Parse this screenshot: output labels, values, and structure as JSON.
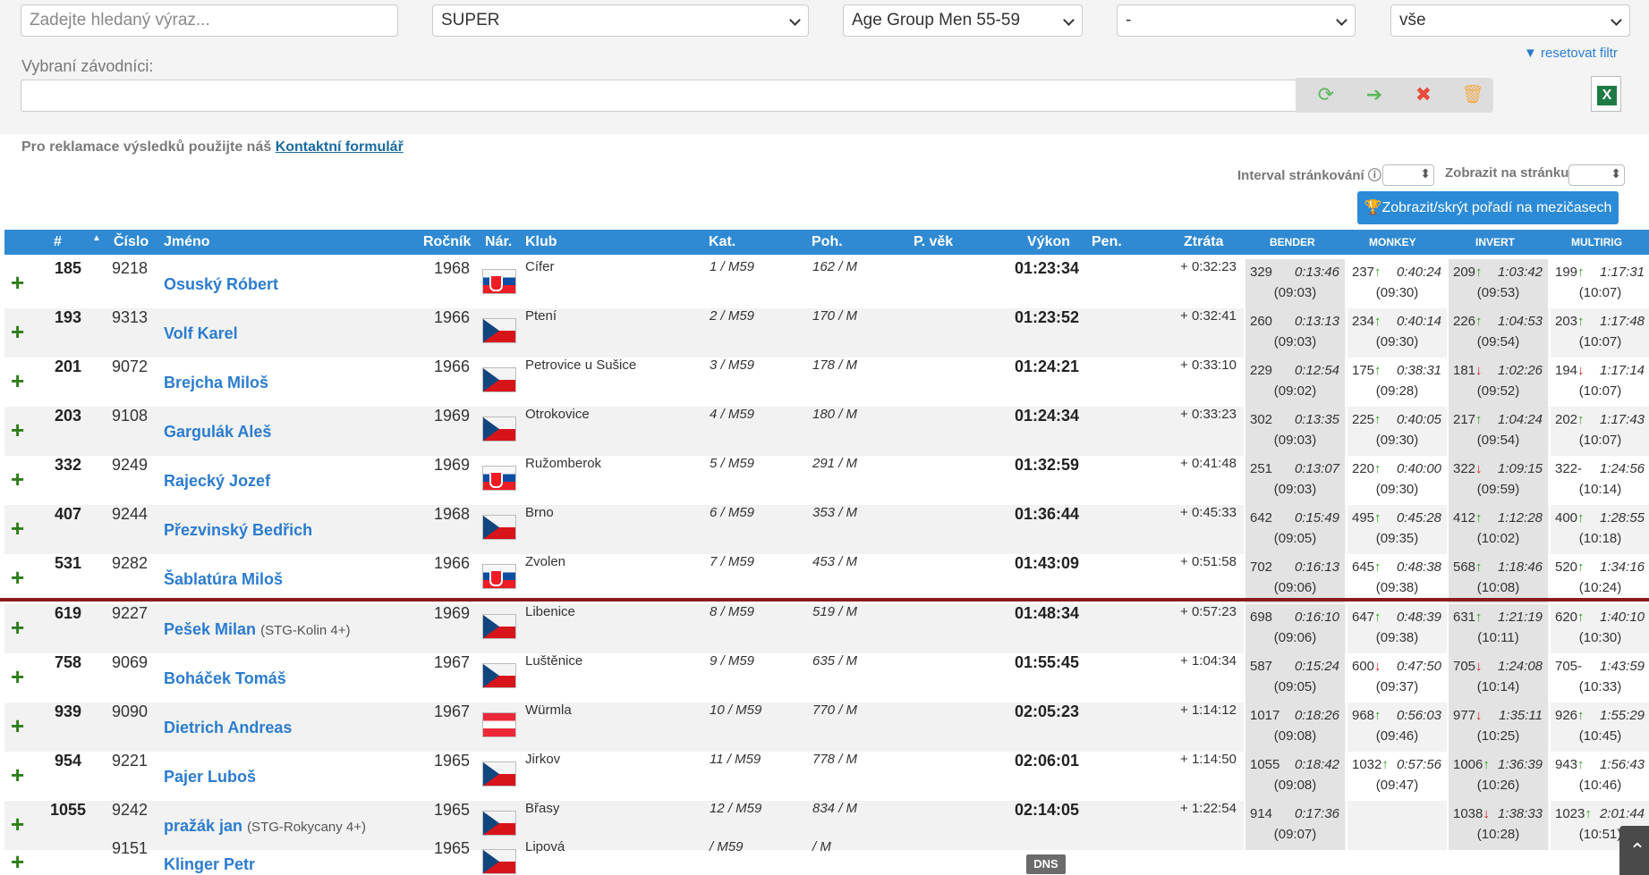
{
  "filters": {
    "search_placeholder": "Zadejte hledaný výraz...",
    "race": "SUPER",
    "category": "Age Group Men 55-59",
    "filter3": "-",
    "filter4": "vše",
    "reset_label": "resetovat filtr",
    "selected_label": "Vybraní závodníci:"
  },
  "notice": {
    "text": "Pro reklamace výsledků použijte náš ",
    "link": "Kontaktní formulář"
  },
  "paging": {
    "interval_label": "Interval stránkování",
    "per_page_label": "Zobrazit na stránku",
    "split_button": "Zobrazit/skrýt pořadí na mezičasech"
  },
  "headers": {
    "rank": "#",
    "number": "Číslo",
    "name": "Jméno",
    "year": "Ročník",
    "nat": "Nár.",
    "club": "Klub",
    "kat": "Kat.",
    "poh": "Poh.",
    "pvek": "P. věk",
    "vykon": "Výkon",
    "pen": "Pen.",
    "ztrata": "Ztráta",
    "splits": [
      "BENDER",
      "MONKEY",
      "INVERT",
      "MULTIRIG"
    ]
  },
  "rows": [
    {
      "rank": "185",
      "number": "9218",
      "name": "Osuský Róbert",
      "team": "",
      "year": "1968",
      "flag": "sk",
      "club": "Cífer",
      "kat": "1 / M59",
      "poh": "162 / M",
      "vykon": "01:23:34",
      "ztrata": "+ 0:32:23",
      "splits": [
        {
          "r": "329",
          "a": "",
          "t": "0:13:46",
          "p": "(09:03)"
        },
        {
          "r": "237",
          "a": "up",
          "t": "0:40:24",
          "p": "(09:30)"
        },
        {
          "r": "209",
          "a": "up",
          "t": "1:03:42",
          "p": "(09:53)"
        },
        {
          "r": "199",
          "a": "up",
          "t": "1:17:31",
          "p": "(10:07)"
        }
      ]
    },
    {
      "rank": "193",
      "number": "9313",
      "name": "Volf Karel",
      "team": "",
      "year": "1966",
      "flag": "cz",
      "club": "Ptení",
      "kat": "2 / M59",
      "poh": "170 / M",
      "vykon": "01:23:52",
      "ztrata": "+ 0:32:41",
      "splits": [
        {
          "r": "260",
          "a": "",
          "t": "0:13:13",
          "p": "(09:03)"
        },
        {
          "r": "234",
          "a": "up",
          "t": "0:40:14",
          "p": "(09:30)"
        },
        {
          "r": "226",
          "a": "up",
          "t": "1:04:53",
          "p": "(09:54)"
        },
        {
          "r": "203",
          "a": "up",
          "t": "1:17:48",
          "p": "(10:07)"
        }
      ]
    },
    {
      "rank": "201",
      "number": "9072",
      "name": "Brejcha Miloš",
      "team": "",
      "year": "1966",
      "flag": "cz",
      "club": "Petrovice u Sušice",
      "kat": "3 / M59",
      "poh": "178 / M",
      "vykon": "01:24:21",
      "ztrata": "+ 0:33:10",
      "splits": [
        {
          "r": "229",
          "a": "",
          "t": "0:12:54",
          "p": "(09:02)"
        },
        {
          "r": "175",
          "a": "up",
          "t": "0:38:31",
          "p": "(09:28)"
        },
        {
          "r": "181",
          "a": "down",
          "t": "1:02:26",
          "p": "(09:52)"
        },
        {
          "r": "194",
          "a": "down",
          "t": "1:17:14",
          "p": "(10:07)"
        }
      ]
    },
    {
      "rank": "203",
      "number": "9108",
      "name": "Gargulák Aleš",
      "team": "",
      "year": "1969",
      "flag": "cz",
      "club": "Otrokovice",
      "kat": "4 / M59",
      "poh": "180 / M",
      "vykon": "01:24:34",
      "ztrata": "+ 0:33:23",
      "splits": [
        {
          "r": "302",
          "a": "",
          "t": "0:13:35",
          "p": "(09:03)"
        },
        {
          "r": "225",
          "a": "up",
          "t": "0:40:05",
          "p": "(09:30)"
        },
        {
          "r": "217",
          "a": "up",
          "t": "1:04:24",
          "p": "(09:54)"
        },
        {
          "r": "202",
          "a": "up",
          "t": "1:17:43",
          "p": "(10:07)"
        }
      ]
    },
    {
      "rank": "332",
      "number": "9249",
      "name": "Rajecký Jozef",
      "team": "",
      "year": "1969",
      "flag": "sk",
      "club": "Ružomberok",
      "kat": "5 / M59",
      "poh": "291 / M",
      "vykon": "01:32:59",
      "ztrata": "+ 0:41:48",
      "splits": [
        {
          "r": "251",
          "a": "",
          "t": "0:13:07",
          "p": "(09:03)"
        },
        {
          "r": "220",
          "a": "up",
          "t": "0:40:00",
          "p": "(09:30)"
        },
        {
          "r": "322",
          "a": "down",
          "t": "1:09:15",
          "p": "(09:59)"
        },
        {
          "r": "322-",
          "a": "",
          "t": "1:24:56",
          "p": "(10:14)"
        }
      ]
    },
    {
      "rank": "407",
      "number": "9244",
      "name": "Přezvinský Bedřich",
      "team": "",
      "year": "1968",
      "flag": "cz",
      "club": "Brno",
      "kat": "6 / M59",
      "poh": "353 / M",
      "vykon": "01:36:44",
      "ztrata": "+ 0:45:33",
      "splits": [
        {
          "r": "642",
          "a": "",
          "t": "0:15:49",
          "p": "(09:05)"
        },
        {
          "r": "495",
          "a": "up",
          "t": "0:45:28",
          "p": "(09:35)"
        },
        {
          "r": "412",
          "a": "up",
          "t": "1:12:28",
          "p": "(10:02)"
        },
        {
          "r": "400",
          "a": "up",
          "t": "1:28:55",
          "p": "(10:18)"
        }
      ]
    },
    {
      "rank": "531",
      "number": "9282",
      "name": "Šablatúra Miloš",
      "team": "",
      "year": "1966",
      "flag": "sk",
      "club": "Zvolen",
      "kat": "7 / M59",
      "poh": "453 / M",
      "vykon": "01:43:09",
      "ztrata": "+ 0:51:58",
      "splits": [
        {
          "r": "702",
          "a": "",
          "t": "0:16:13",
          "p": "(09:06)"
        },
        {
          "r": "645",
          "a": "up",
          "t": "0:48:38",
          "p": "(09:38)"
        },
        {
          "r": "568",
          "a": "up",
          "t": "1:18:46",
          "p": "(10:08)"
        },
        {
          "r": "520",
          "a": "up",
          "t": "1:34:16",
          "p": "(10:24)"
        }
      ]
    },
    {
      "rank": "619",
      "number": "9227",
      "name": "Pešek Milan",
      "team": "(STG-Kolin 4+)",
      "year": "1969",
      "flag": "cz",
      "club": "Libenice",
      "kat": "8 / M59",
      "poh": "519 / M",
      "vykon": "01:48:34",
      "ztrata": "+ 0:57:23",
      "splits": [
        {
          "r": "698",
          "a": "",
          "t": "0:16:10",
          "p": "(09:06)"
        },
        {
          "r": "647",
          "a": "up",
          "t": "0:48:39",
          "p": "(09:38)"
        },
        {
          "r": "631",
          "a": "up",
          "t": "1:21:19",
          "p": "(10:11)"
        },
        {
          "r": "620",
          "a": "up",
          "t": "1:40:10",
          "p": "(10:30)"
        }
      ]
    },
    {
      "rank": "758",
      "number": "9069",
      "name": "Boháček Tomáš",
      "team": "",
      "year": "1967",
      "flag": "cz",
      "club": "Luštěnice",
      "kat": "9 / M59",
      "poh": "635 / M",
      "vykon": "01:55:45",
      "ztrata": "+ 1:04:34",
      "splits": [
        {
          "r": "587",
          "a": "",
          "t": "0:15:24",
          "p": "(09:05)"
        },
        {
          "r": "600",
          "a": "down",
          "t": "0:47:50",
          "p": "(09:37)"
        },
        {
          "r": "705",
          "a": "down",
          "t": "1:24:08",
          "p": "(10:14)"
        },
        {
          "r": "705-",
          "a": "",
          "t": "1:43:59",
          "p": "(10:33)"
        }
      ]
    },
    {
      "rank": "939",
      "number": "9090",
      "name": "Dietrich Andreas",
      "team": "",
      "year": "1967",
      "flag": "at",
      "club": "Würmla",
      "kat": "10 / M59",
      "poh": "770 / M",
      "vykon": "02:05:23",
      "ztrata": "+ 1:14:12",
      "splits": [
        {
          "r": "1017",
          "a": "",
          "t": "0:18:26",
          "p": "(09:08)"
        },
        {
          "r": "968",
          "a": "up",
          "t": "0:56:03",
          "p": "(09:46)"
        },
        {
          "r": "977",
          "a": "down",
          "t": "1:35:11",
          "p": "(10:25)"
        },
        {
          "r": "926",
          "a": "up",
          "t": "1:55:29",
          "p": "(10:45)"
        }
      ]
    },
    {
      "rank": "954",
      "number": "9221",
      "name": "Pajer Luboš",
      "team": "",
      "year": "1965",
      "flag": "cz",
      "club": "Jirkov",
      "kat": "11 / M59",
      "poh": "778 / M",
      "vykon": "02:06:01",
      "ztrata": "+ 1:14:50",
      "splits": [
        {
          "r": "1055",
          "a": "",
          "t": "0:18:42",
          "p": "(09:08)"
        },
        {
          "r": "1032",
          "a": "up",
          "t": "0:57:56",
          "p": "(09:47)"
        },
        {
          "r": "1006",
          "a": "up",
          "t": "1:36:39",
          "p": "(10:26)"
        },
        {
          "r": "943",
          "a": "up",
          "t": "1:56:43",
          "p": "(10:46)"
        }
      ]
    },
    {
      "rank": "1055",
      "number": "9242",
      "name": "pražák jan",
      "team": "(STG-Rokycany 4+)",
      "year": "1965",
      "flag": "cz",
      "club": "Břasy",
      "kat": "12 / M59",
      "poh": "834 / M",
      "vykon": "02:14:05",
      "ztrata": "+ 1:22:54",
      "splits": [
        {
          "r": "914",
          "a": "",
          "t": "0:17:36",
          "p": "(09:07)"
        },
        {
          "r": "",
          "a": "",
          "t": "",
          "p": ""
        },
        {
          "r": "1038",
          "a": "down",
          "t": "1:38:33",
          "p": "(10:28)"
        },
        {
          "r": "1023",
          "a": "up",
          "t": "2:01:44",
          "p": "(10:51)"
        }
      ]
    },
    {
      "rank": "",
      "number": "9151",
      "name": "Klinger Petr",
      "team": "",
      "year": "1965",
      "flag": "cz",
      "club": "Lipová",
      "kat": "/ M59",
      "poh": "/ M",
      "vykon": "",
      "ztrata": "",
      "status": "DNS",
      "splits": []
    }
  ]
}
